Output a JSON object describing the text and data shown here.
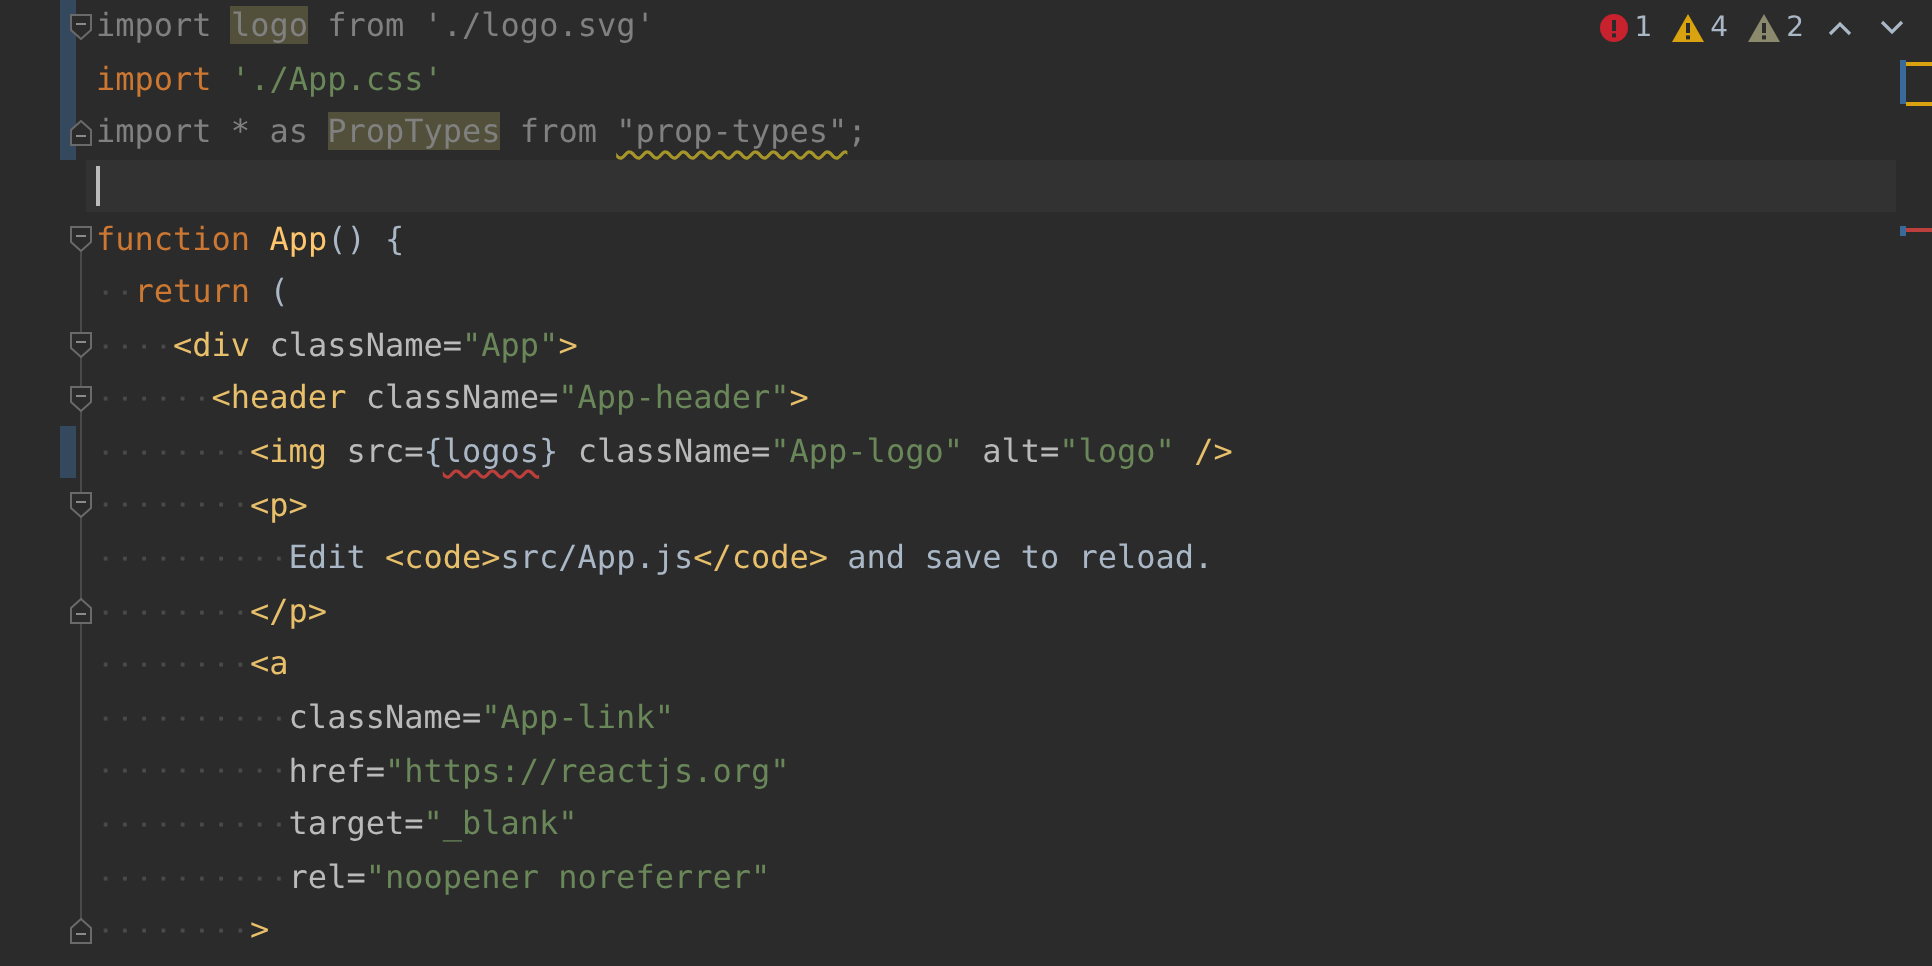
{
  "inspections": [
    {
      "kind": "error",
      "count": "1"
    },
    {
      "kind": "warning",
      "count": "4"
    },
    {
      "kind": "weak_warning",
      "count": "2"
    }
  ],
  "lines": [
    {
      "changed": true,
      "current": false,
      "fold_start": true,
      "tokens": [
        {
          "kind": "unused",
          "text": "import "
        },
        {
          "kind": "highlighted",
          "text": "logo"
        },
        {
          "kind": "unused",
          "text": " from './logo.svg'"
        }
      ]
    },
    {
      "changed": true,
      "current": false,
      "tokens": [
        {
          "kind": "keyword",
          "text": "import "
        },
        {
          "kind": "string",
          "text": "'./App.css'"
        }
      ]
    },
    {
      "changed": true,
      "current": false,
      "fold_end": true,
      "tokens": [
        {
          "kind": "unused",
          "text": "import * as "
        },
        {
          "kind": "highlighted",
          "text": "PropTypes"
        },
        {
          "kind": "unused",
          "text": " from "
        },
        {
          "kind": "unused",
          "text": "\"prop-types\"",
          "warning_underline": true
        },
        {
          "kind": "unused",
          "text": ";"
        }
      ]
    },
    {
      "changed": false,
      "current": true
    },
    {
      "changed": false,
      "current": false,
      "fold_start": true,
      "tokens": [
        {
          "kind": "keyword",
          "text": "function "
        },
        {
          "kind": "func",
          "text": "App"
        },
        {
          "kind": "text",
          "text": "() {"
        }
      ],
      "children": [
        {
          "changed": false,
          "current": false,
          "tokens": [
            {
              "kind": "keyword",
              "text": "return "
            },
            {
              "kind": "text",
              "text": "("
            }
          ],
          "children": [
            {
              "changed": false,
              "current": false,
              "fold_start": true,
              "tokens": [
                {
                  "kind": "tag",
                  "text": "<div "
                },
                {
                  "kind": "attr",
                  "text": "className="
                },
                {
                  "kind": "string",
                  "text": "\"App\""
                },
                {
                  "kind": "tag",
                  "text": ">"
                }
              ],
              "children": [
                {
                  "changed": false,
                  "current": false,
                  "fold_start": true,
                  "tokens": [
                    {
                      "kind": "tag",
                      "text": "<header "
                    },
                    {
                      "kind": "attr",
                      "text": "className="
                    },
                    {
                      "kind": "string",
                      "text": "\"App-header\""
                    },
                    {
                      "kind": "tag",
                      "text": ">"
                    }
                  ],
                  "children": [
                    {
                      "changed": true,
                      "current": false,
                      "tokens": [
                        {
                          "kind": "tag",
                          "text": "<img "
                        },
                        {
                          "kind": "attr",
                          "text": "src="
                        },
                        {
                          "kind": "text",
                          "text": "{"
                        },
                        {
                          "kind": "text",
                          "text": "logos",
                          "error_underline": true
                        },
                        {
                          "kind": "text",
                          "text": "} "
                        },
                        {
                          "kind": "attr",
                          "text": "className="
                        },
                        {
                          "kind": "string",
                          "text": "\"App-logo\" "
                        },
                        {
                          "kind": "attr",
                          "text": "alt="
                        },
                        {
                          "kind": "string",
                          "text": "\"logo\" "
                        },
                        {
                          "kind": "tag",
                          "text": "/>"
                        }
                      ]
                    },
                    {
                      "changed": false,
                      "current": false,
                      "fold_start": true,
                      "tokens": [
                        {
                          "kind": "tag",
                          "text": "<p>"
                        }
                      ],
                      "children": [
                        {
                          "changed": false,
                          "current": false,
                          "tokens": [
                            {
                              "kind": "text",
                              "text": "Edit "
                            },
                            {
                              "kind": "tag",
                              "text": "<code>"
                            },
                            {
                              "kind": "text",
                              "text": "src/App.js"
                            },
                            {
                              "kind": "tag",
                              "text": "</code>"
                            },
                            {
                              "kind": "text",
                              "text": " and save to reload."
                            }
                          ]
                        }
                      ]
                    },
                    {
                      "changed": false,
                      "current": false,
                      "fold_end": true,
                      "tokens": [
                        {
                          "kind": "tag",
                          "text": "</p>"
                        }
                      ]
                    },
                    {
                      "changed": false,
                      "current": false,
                      "tokens": [
                        {
                          "kind": "tag",
                          "text": "<a"
                        }
                      ],
                      "children": [
                        {
                          "changed": false,
                          "current": false,
                          "tokens": [
                            {
                              "kind": "attr",
                              "text": "className="
                            },
                            {
                              "kind": "string",
                              "text": "\"App-link\""
                            }
                          ]
                        },
                        {
                          "changed": false,
                          "current": false,
                          "tokens": [
                            {
                              "kind": "attr",
                              "text": "href="
                            },
                            {
                              "kind": "string",
                              "text": "\"https://reactjs.org\""
                            }
                          ]
                        },
                        {
                          "changed": false,
                          "current": false,
                          "tokens": [
                            {
                              "kind": "attr",
                              "text": "target="
                            },
                            {
                              "kind": "string",
                              "text": "\"_blank\""
                            }
                          ]
                        },
                        {
                          "changed": false,
                          "current": false,
                          "tokens": [
                            {
                              "kind": "attr",
                              "text": "rel="
                            },
                            {
                              "kind": "string",
                              "text": "\"noopener noreferrer\""
                            }
                          ]
                        }
                      ]
                    },
                    {
                      "changed": false,
                      "current": false,
                      "fold_end": true,
                      "tokens": [
                        {
                          "kind": "tag",
                          "text": ">"
                        }
                      ]
                    }
                  ]
                }
              ]
            }
          ]
        }
      ]
    }
  ]
}
